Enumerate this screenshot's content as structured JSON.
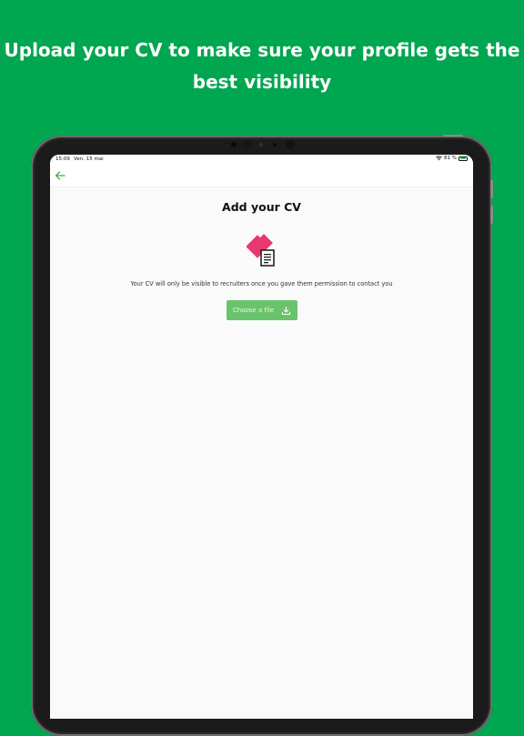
{
  "promo": {
    "headline_line1": "Upload your CV to make sure your profile gets the",
    "headline_line2": "best visibility"
  },
  "status_bar": {
    "time": "15:09",
    "date": "Ven. 15 mai",
    "battery": "81 %",
    "battery_level": 0.81
  },
  "nav": {
    "back_icon": "arrow-left-icon"
  },
  "page": {
    "title": "Add your CV",
    "description": "Your CV will only be visible to recruiters once you gave them permission to contact you",
    "choose_file_label": "Choose a file",
    "choose_file_icon": "download-icon"
  },
  "colors": {
    "background": "#00a650",
    "accent": "#68c36a",
    "illustration_pink": "#e8386f"
  }
}
